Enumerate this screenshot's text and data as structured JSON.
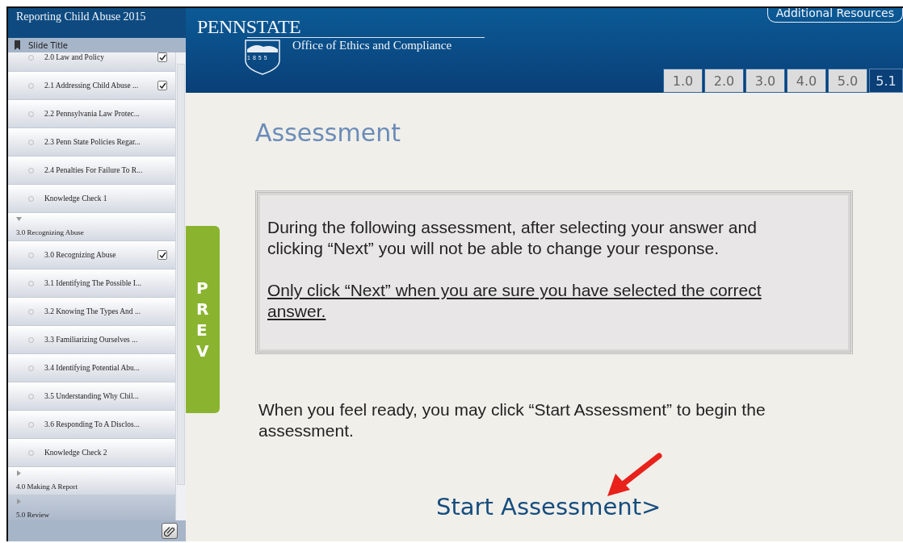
{
  "sidebar": {
    "title": "Reporting Child Abuse 2015",
    "header": "Slide Title",
    "items": [
      {
        "kind": "slide",
        "label": "2.0 Law and Policy",
        "checked": true,
        "selected": false
      },
      {
        "kind": "slide",
        "label": "2.1 Addressing Child Abuse ...",
        "checked": true,
        "selected": false
      },
      {
        "kind": "slide",
        "label": "2.2 Pennsylvania Law Protec...",
        "checked": false,
        "selected": false
      },
      {
        "kind": "slide",
        "label": "2.3 Penn State Policies Regar...",
        "checked": false,
        "selected": false
      },
      {
        "kind": "slide",
        "label": "2.4 Penalties For Failure To R...",
        "checked": false,
        "selected": false
      },
      {
        "kind": "slide",
        "label": "Knowledge Check 1",
        "checked": false,
        "selected": false
      },
      {
        "kind": "section",
        "label": "3.0 Recognizing Abuse",
        "expanded": true,
        "selected": false,
        "children": [
          {
            "kind": "slide",
            "label": "3.0 Recognizing Abuse",
            "checked": true,
            "selected": false
          },
          {
            "kind": "slide",
            "label": "3.1 Identifying The Possible I...",
            "checked": false,
            "selected": false
          },
          {
            "kind": "slide",
            "label": "3.2 Knowing The Types And ...",
            "checked": false,
            "selected": false
          },
          {
            "kind": "slide",
            "label": "3.3 Familiarizing Ourselves ...",
            "checked": false,
            "selected": false
          },
          {
            "kind": "slide",
            "label": "3.4 Identifying Potential Abu...",
            "checked": false,
            "selected": false
          },
          {
            "kind": "slide",
            "label": "3.5 Understanding Why Chil...",
            "checked": false,
            "selected": false
          },
          {
            "kind": "slide",
            "label": "3.6 Responding To A Disclos...",
            "checked": false,
            "selected": false
          },
          {
            "kind": "slide",
            "label": "Knowledge Check 2",
            "checked": false,
            "selected": false
          }
        ]
      },
      {
        "kind": "section",
        "label": "4.0 Making A Report",
        "expanded": false,
        "selected": false
      },
      {
        "kind": "section",
        "label": "5.0 Review",
        "expanded": false,
        "selected": true
      }
    ]
  },
  "header": {
    "logo": "PENNSTATE",
    "seal_year": "1855",
    "office": "Office of Ethics and Compliance",
    "resources_button": "Additional Resources",
    "tabs": [
      {
        "label": "1.0",
        "selected": false
      },
      {
        "label": "2.0",
        "selected": false
      },
      {
        "label": "3.0",
        "selected": false
      },
      {
        "label": "4.0",
        "selected": false
      },
      {
        "label": "5.0",
        "selected": false
      },
      {
        "label": "5.1",
        "selected": true
      }
    ]
  },
  "prev_tab": "PREV",
  "content": {
    "title": "Assessment",
    "notice": "During the following assessment, after selecting your answer and clicking “Next” you will not be able to change your response.",
    "warning": "Only click “Next” when you are sure you have selected the correct answer.",
    "instruction": "When you feel ready, you may click “Start Assessment” to begin the assessment.",
    "start_link": "Start Assessment>"
  }
}
